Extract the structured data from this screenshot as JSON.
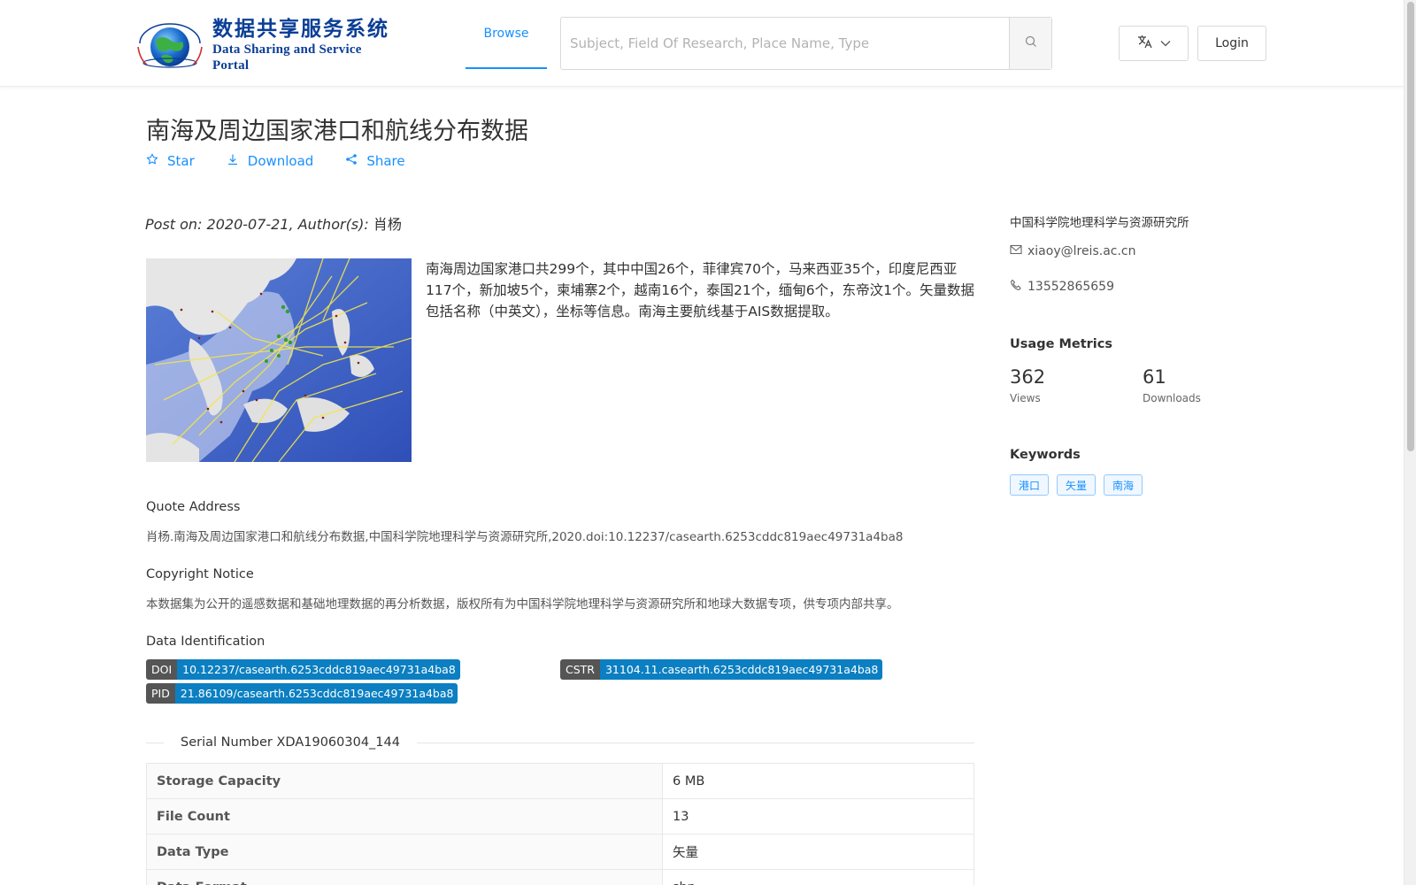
{
  "header": {
    "logo_cn": "数据共享服务系统",
    "logo_en": "Data Sharing and Service Portal",
    "nav_browse": "Browse",
    "search_placeholder": "Subject, Field Of Research, Place Name, Type",
    "login": "Login",
    "accent_color": "#1890ff"
  },
  "dataset": {
    "title": "南海及周边国家港口和航线分布数据",
    "actions": {
      "star": "Star",
      "download": "Download",
      "share": "Share"
    },
    "post_on_label": "Post on: 2020-07-21, Author(s):",
    "author": "肖杨",
    "description": "南海周边国家港口共299个，其中中国26个，菲律宾70个，马来西亚35个，印度尼西亚117个，新加坡5个，柬埔寨2个，越南16个，泰国21个，缅甸6个，东帝汶1个。矢量数据包括名称（中英文），坐标等信息。南海主要航线基于AIS数据提取。",
    "quote_label": "Quote Address",
    "quote_text": "肖杨.南海及周边国家港口和航线分布数据,中国科学院地理科学与资源研究所,2020.doi:10.12237/casearth.6253cddc819aec49731a4ba8",
    "copyright_label": "Copyright Notice",
    "copyright_text": "本数据集为公开的遥感数据和基础地理数据的再分析数据，版权所有为中国科学院地理科学与资源研究所和地球大数据专项，供专项内部共享。",
    "ident_label": "Data Identification",
    "doi_key": "DOI",
    "doi_val": "10.12237/casearth.6253cddc819aec49731a4ba8",
    "cstr_key": "CSTR",
    "cstr_val": "31104.11.casearth.6253cddc819aec49731a4ba8",
    "pid_key": "PID",
    "pid_val": "21.86109/casearth.6253cddc819aec49731a4ba8",
    "serial": "Serial Number XDA19060304_144",
    "table": [
      {
        "key": "Storage Capacity",
        "value": "6 MB"
      },
      {
        "key": "File Count",
        "value": "13"
      },
      {
        "key": "Data Type",
        "value": "矢量"
      },
      {
        "key": "Data Format",
        "value": "shp"
      }
    ]
  },
  "sidebar": {
    "org": "中国科学院地理科学与资源研究所",
    "email": "xiaoy@lreis.ac.cn",
    "phone": "13552865659",
    "metrics_heading": "Usage Metrics",
    "views_num": "362",
    "views_label": "Views",
    "downloads_num": "61",
    "downloads_label": "Downloads",
    "keywords_heading": "Keywords",
    "keywords": [
      "港口",
      "矢量",
      "南海"
    ]
  }
}
